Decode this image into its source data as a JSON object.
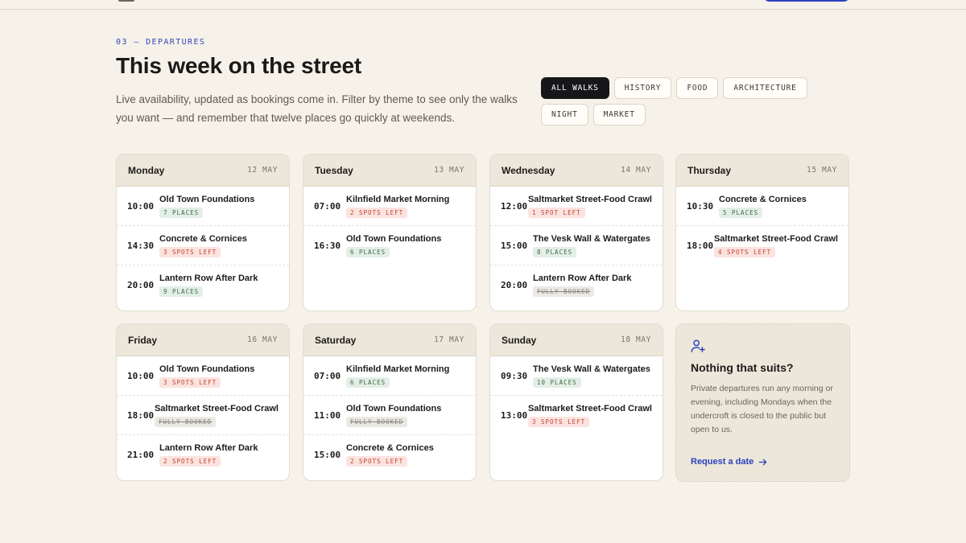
{
  "section": {
    "eyebrow": "03 — DEPARTURES",
    "title": "This week on the street",
    "subtitle": "Live availability, updated as bookings come in. Filter by theme to see only the walks you want — and remember that twelve places go quickly at weekends."
  },
  "filters": [
    "ALL WALKS",
    "HISTORY",
    "FOOD",
    "ARCHITECTURE",
    "NIGHT",
    "MARKET"
  ],
  "active_filter": "ALL WALKS",
  "days": [
    {
      "day": "Monday",
      "date": "12 MAY",
      "slots": [
        {
          "time": "10:00",
          "walk": "Old Town Foundations",
          "status": "7 PLACES",
          "kind": "ok"
        },
        {
          "time": "14:30",
          "walk": "Concrete & Cornices",
          "status": "3 SPOTS LEFT",
          "kind": "low"
        },
        {
          "time": "20:00",
          "walk": "Lantern Row After Dark",
          "status": "9 PLACES",
          "kind": "ok"
        }
      ]
    },
    {
      "day": "Tuesday",
      "date": "13 MAY",
      "slots": [
        {
          "time": "07:00",
          "walk": "Kilnfield Market Morning",
          "status": "2 SPOTS LEFT",
          "kind": "low"
        },
        {
          "time": "16:30",
          "walk": "Old Town Foundations",
          "status": "6 PLACES",
          "kind": "ok"
        }
      ]
    },
    {
      "day": "Wednesday",
      "date": "14 MAY",
      "slots": [
        {
          "time": "12:00",
          "walk": "Saltmarket Street-Food Crawl",
          "status": "1 SPOT LEFT",
          "kind": "low"
        },
        {
          "time": "15:00",
          "walk": "The Vesk Wall & Watergates",
          "status": "8 PLACES",
          "kind": "ok"
        },
        {
          "time": "20:00",
          "walk": "Lantern Row After Dark",
          "status": "FULLY BOOKED",
          "kind": "full"
        }
      ]
    },
    {
      "day": "Thursday",
      "date": "15 MAY",
      "slots": [
        {
          "time": "10:30",
          "walk": "Concrete & Cornices",
          "status": "5 PLACES",
          "kind": "ok"
        },
        {
          "time": "18:00",
          "walk": "Saltmarket Street-Food Crawl",
          "status": "4 SPOTS LEFT",
          "kind": "low"
        }
      ]
    },
    {
      "day": "Friday",
      "date": "16 MAY",
      "slots": [
        {
          "time": "10:00",
          "walk": "Old Town Foundations",
          "status": "3 SPOTS LEFT",
          "kind": "low"
        },
        {
          "time": "18:00",
          "walk": "Saltmarket Street-Food Crawl",
          "status": "FULLY BOOKED",
          "kind": "full"
        },
        {
          "time": "21:00",
          "walk": "Lantern Row After Dark",
          "status": "2 SPOTS LEFT",
          "kind": "low"
        }
      ]
    },
    {
      "day": "Saturday",
      "date": "17 MAY",
      "slots": [
        {
          "time": "07:00",
          "walk": "Kilnfield Market Morning",
          "status": "6 PLACES",
          "kind": "ok"
        },
        {
          "time": "11:00",
          "walk": "Old Town Foundations",
          "status": "FULLY BOOKED",
          "kind": "full"
        },
        {
          "time": "15:00",
          "walk": "Concrete & Cornices",
          "status": "2 SPOTS LEFT",
          "kind": "low"
        }
      ]
    },
    {
      "day": "Sunday",
      "date": "18 MAY",
      "slots": [
        {
          "time": "09:30",
          "walk": "The Vesk Wall & Watergates",
          "status": "10 PLACES",
          "kind": "ok"
        },
        {
          "time": "13:00",
          "walk": "Saltmarket Street-Food Crawl",
          "status": "3 SPOTS LEFT",
          "kind": "low"
        }
      ]
    }
  ],
  "suggest": {
    "icon": "add-user-icon",
    "title": "Nothing that suits?",
    "body": "Private departures run any morning or evening, including Mondays when the undercroft is closed to the public but open to us.",
    "link": "Request a date",
    "link_icon": "arrow-right-icon"
  },
  "colors": {
    "background": "#f6f2ea",
    "accent": "#2d3fbf",
    "available": "#3f6b4c",
    "low": "#c2412f",
    "full": "#8a857b"
  }
}
